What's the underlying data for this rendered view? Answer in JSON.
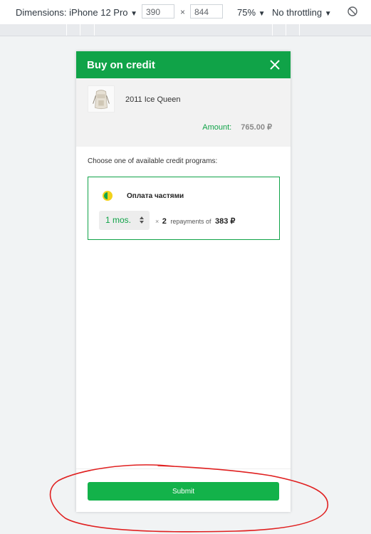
{
  "devtools": {
    "dimensions_label": "Dimensions: iPhone 12 Pro",
    "width_value": "390",
    "times_sign": "×",
    "height_value": "844",
    "zoom_label": "75%",
    "throttling_label": "No throttling",
    "dropdown_arrow": "▼"
  },
  "modal": {
    "title": "Buy on credit",
    "product": {
      "name": "2011 Ice Queen",
      "amount_label": "Amount:",
      "amount_value": "765.00 ₽"
    },
    "prompt": "Choose one of available credit programs:",
    "program": {
      "name": "Оплата частями",
      "term_value": "1 mos.",
      "times_sign": "×",
      "repayments_count": "2",
      "repayments_text": "repayments of",
      "repayment_amount": "383 ₽"
    },
    "submit_label": "Submit"
  },
  "colors": {
    "brand_green": "#10a348",
    "button_green": "#13b24a",
    "annotation_red": "#e02020"
  }
}
